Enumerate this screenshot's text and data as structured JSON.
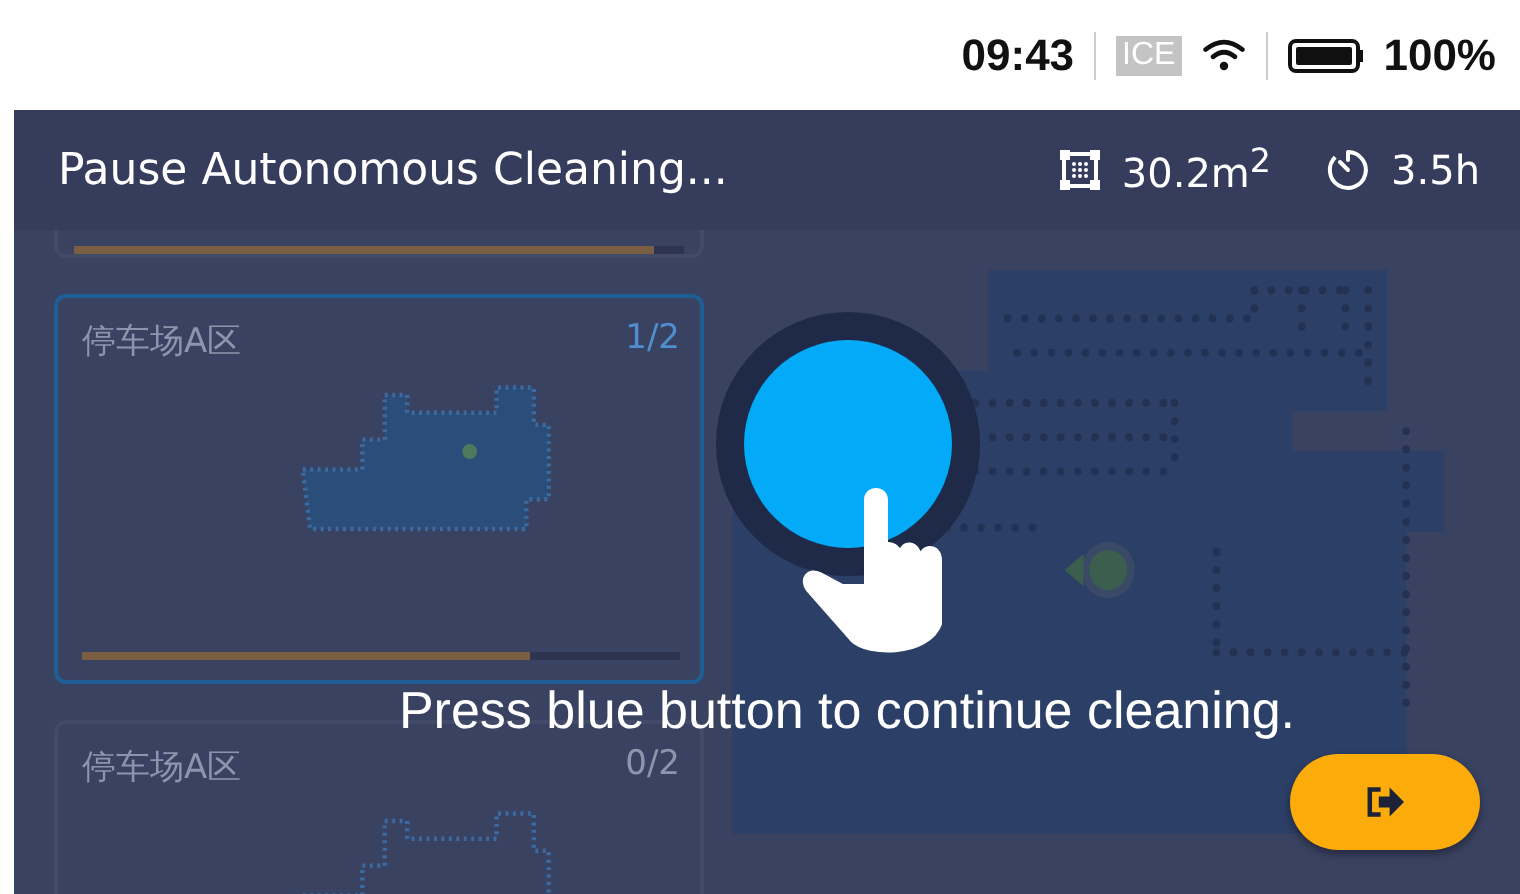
{
  "status_bar": {
    "time": "09:43",
    "network": "ICE",
    "battery": "100%"
  },
  "header": {
    "title": "Pause Autonomous Cleaning...",
    "area": "30.2m$^{2}$",
    "duration": "3.5h"
  },
  "zones": [
    {
      "selected": false,
      "level": 0.95
    },
    {
      "name": "停车场A区",
      "count": "1/2",
      "selected": true,
      "level": 0.75
    },
    {
      "name": "停车场A区",
      "count": "0/2",
      "selected": false
    }
  ],
  "overlay": {
    "message": "Press blue button to continue cleaning."
  }
}
